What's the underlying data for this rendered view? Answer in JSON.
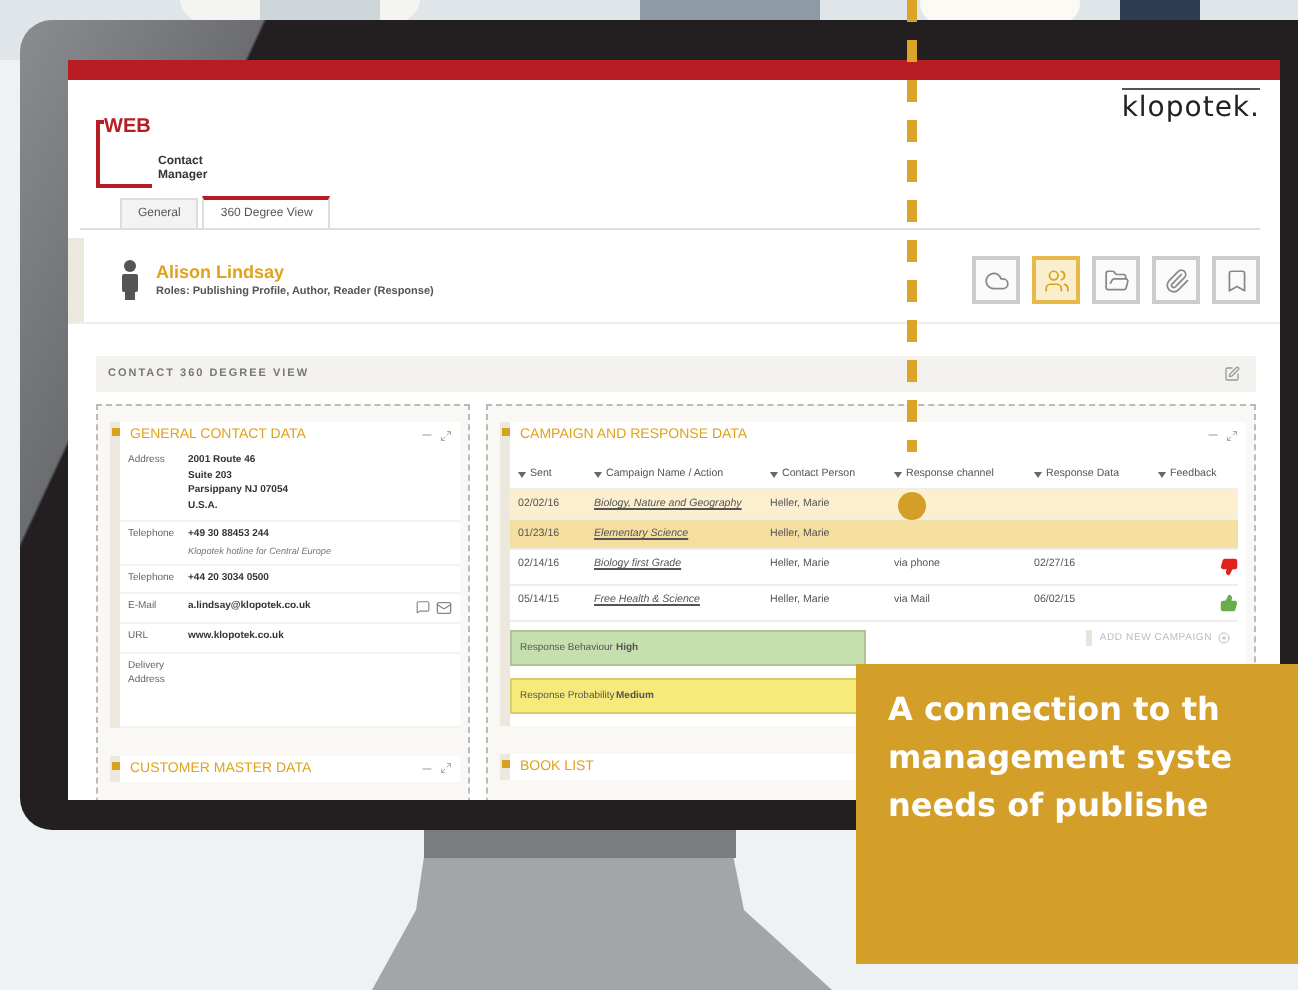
{
  "logo": {
    "mark": "WEB",
    "line1": "Contact",
    "line2": "Manager"
  },
  "brand": "klopotek.",
  "tabs": [
    {
      "label": "General",
      "selected": false
    },
    {
      "label": "360 Degree View",
      "selected": true
    }
  ],
  "contact": {
    "name": "Alison Lindsay",
    "roles": "Roles: Publishing Profile, Author, Reader (Response)"
  },
  "toolbar": [
    {
      "kind": "cloud",
      "selected": false
    },
    {
      "kind": "people",
      "selected": true
    },
    {
      "kind": "folder",
      "selected": false
    },
    {
      "kind": "clip",
      "selected": false
    },
    {
      "kind": "bookmark",
      "selected": false
    }
  ],
  "section_title": "CONTACT 360 DEGREE VIEW",
  "general_contact": {
    "title": "GENERAL CONTACT DATA",
    "fields": [
      {
        "label": "Address",
        "lines": [
          "2001 Route 46",
          "Suite 203",
          "Parsippany NJ 07054",
          "U.S.A."
        ]
      },
      {
        "label": "Telephone",
        "lines": [
          "+49 30 88453 244"
        ],
        "note": "Klopotek hotline for Central Europe"
      },
      {
        "label": "Telephone",
        "lines": [
          "+44 20 3034 0500"
        ]
      },
      {
        "label": "E-Mail",
        "lines": [
          "a.lindsay@klopotek.co.uk"
        ],
        "kind": "email"
      },
      {
        "label": "URL",
        "lines": [
          "www.klopotek.co.uk"
        ]
      },
      {
        "label": "Delivery Address",
        "kind": "tall"
      }
    ]
  },
  "customer_master": {
    "title": "CUSTOMER MASTER DATA"
  },
  "campaign": {
    "title": "CAMPAIGN AND RESPONSE DATA",
    "columns": [
      "Sent",
      "Campaign Name / Action",
      "Contact Person",
      "Response channel",
      "Response Data",
      "Feedback"
    ],
    "rows": [
      {
        "sent": "02/02/16",
        "campaign": "Biology, Nature and Geography",
        "contact": "Heller, Marie",
        "kind": "plain",
        "color": "#fbefcf"
      },
      {
        "sent": "01/23/16",
        "campaign": "Elementary Science",
        "contact": "Heller, Marie",
        "kind": "plain",
        "color": "#f4dea0"
      },
      {
        "sent": "02/14/16",
        "campaign": "Biology first Grade",
        "contact": "Heller, Marie",
        "channel": "via phone",
        "response": "02/27/16",
        "kind": "down",
        "color": "#ffffff"
      },
      {
        "sent": "05/14/15",
        "campaign": "Free Health & Science",
        "contact": "Heller, Marie",
        "channel": "via Mail",
        "response": "06/02/15",
        "kind": "up",
        "color": "#ffffff"
      }
    ],
    "metrics": [
      {
        "label": "Response Behaviour",
        "value": "High",
        "color": "#c6dfae"
      },
      {
        "label": "Response Probability",
        "value": "Medium",
        "color": "#f5ea7a"
      }
    ],
    "add_button": "ADD NEW CAMPAIGN"
  },
  "book_list": {
    "title": "BOOK LIST"
  },
  "banner": [
    "A connection to th",
    "management syste",
    "needs of publishe"
  ]
}
